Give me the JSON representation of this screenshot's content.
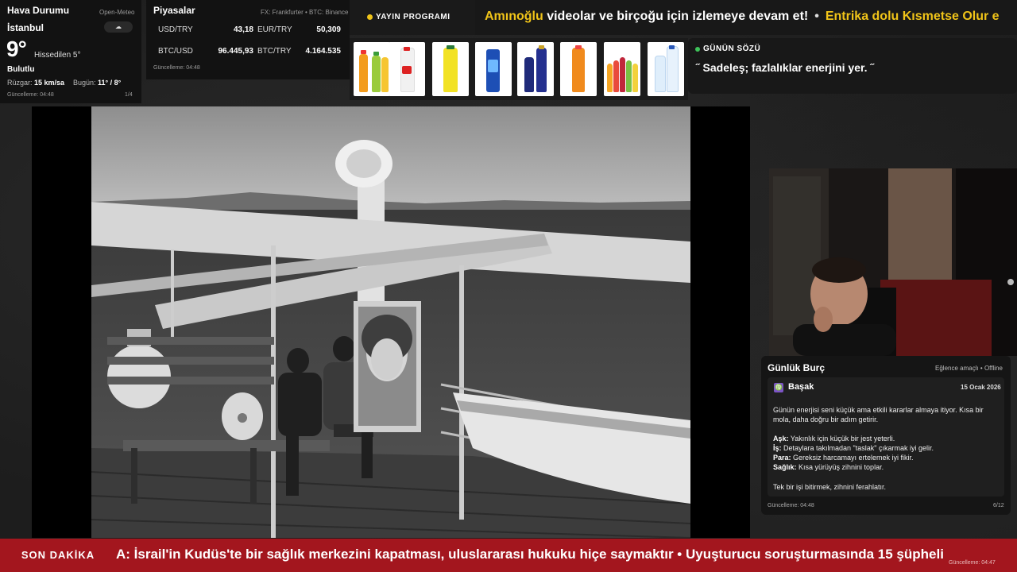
{
  "weather": {
    "title": "Hava Durumu",
    "source": "Open-Meteo",
    "city": "İstanbul",
    "cloud_icon": "☁",
    "temperature": "9°",
    "feels_like": "Hissedilen 5°",
    "condition": "Bulutlu",
    "wind_label": "Rüzgar:",
    "wind_value": "15 km/sa",
    "today_label": "Bugün:",
    "today_value": "11° / 8°",
    "updated": "Güncelleme: 04:48",
    "page": "1/4"
  },
  "markets": {
    "title": "Piyasalar",
    "source": "FX: Frankfurter • BTC: Binance",
    "rates": [
      {
        "label": "USD/TRY",
        "value": "43,18"
      },
      {
        "label": "EUR/TRY",
        "value": "50,309"
      },
      {
        "label": "BTC/USD",
        "value": "96.445,93"
      },
      {
        "label": "BTC/TRY",
        "value": "4.164.535"
      }
    ],
    "updated": "Güncelleme: 04:48"
  },
  "schedule": {
    "label": "YAYIN PROGRAMI"
  },
  "marquee": {
    "part1_highlight": "Amınoğlu",
    "part1_rest": " videolar ve birçoğu için izlemeye devam et!",
    "separator": "•",
    "part2_highlight": "Entrika dolu Kısmetse Olur e"
  },
  "quote": {
    "label": "GÜNÜN SÖZÜ",
    "text": "˝ Sadeleş; fazlalıklar enerjini yer. ˝"
  },
  "horoscope": {
    "title": "Günlük Burç",
    "subtitle": "Eğlence amaçlı • Offline",
    "sign_icon": "♍",
    "sign": "Başak",
    "date": "15 Ocak 2026",
    "intro": "Günün enerjisi seni küçük ama etkili kararlar almaya itiyor. Kısa bir mola, daha doğru bir adım getirir.",
    "love_label": "Aşk:",
    "love": " Yakınlık için küçük bir jest yeterli.",
    "work_label": "İş:",
    "work": " Detaylara takılmadan \"taslak\" çıkarmak iyi gelir.",
    "money_label": "Para:",
    "money": " Gereksiz harcamayı ertelemek iyi fikir.",
    "health_label": "Sağlık:",
    "health": " Kısa yürüyüş zihnini toplar.",
    "closing": "Tek bir işi bitirmek, zihnini ferahlatır.",
    "updated": "Güncelleme: 04:48",
    "page": "6/12"
  },
  "breaking": {
    "label": "SON DAKİKA",
    "news": "A: İsrail'in Kudüs'te bir sağlık merkezini kapatması, uluslararası hukuku hiçe saymaktır  •  Uyuşturucu soruşturmasında 15 şüpheli",
    "updated": "Güncelleme: 04:47"
  },
  "colors": {
    "accent_yellow": "#f0c419",
    "breaking_red": "#a3161e",
    "quote_green": "#3ec35a"
  }
}
